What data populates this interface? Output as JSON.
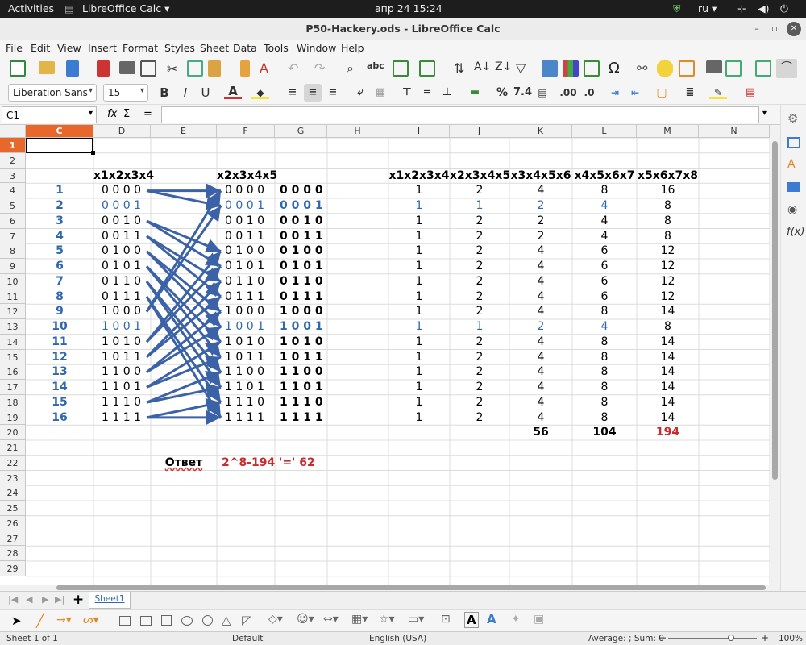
{
  "topbar": {
    "activities": "Activities",
    "app": "LibreOffice Calc",
    "datetime": "апр 24  15:24",
    "lang": "ru"
  },
  "window": {
    "title": "P50-Hackery.ods - LibreOffice Calc"
  },
  "menu": [
    "File",
    "Edit",
    "View",
    "Insert",
    "Format",
    "Styles",
    "Sheet",
    "Data",
    "Tools",
    "Window",
    "Help"
  ],
  "format": {
    "font": "Liberation Sans",
    "size": "15",
    "bold": "B",
    "italic": "I",
    "underline": "U"
  },
  "formula": {
    "cell_ref": "C1",
    "fx": "fx",
    "sigma": "Σ",
    "eq": "="
  },
  "columns": [
    "C",
    "D",
    "E",
    "F",
    "G",
    "H",
    "I",
    "J",
    "K",
    "L",
    "M",
    "N"
  ],
  "rows": [
    "1",
    "2",
    "3",
    "4",
    "5",
    "6",
    "7",
    "8",
    "9",
    "10",
    "11",
    "12",
    "13",
    "14",
    "15",
    "16",
    "17",
    "18",
    "19",
    "20",
    "21",
    "22",
    "23",
    "24",
    "25",
    "26",
    "27",
    "28",
    "29"
  ],
  "headers": {
    "d": "x1x2x3x4",
    "f": "x2x3x4x5",
    "i": "x1x2x3x4",
    "j": "x2x3x4x5",
    "k": "x3x4x5x6",
    "l": "x4x5x6x7",
    "m": "x5x6x7x8"
  },
  "table": [
    {
      "n": "1",
      "d": "0 0 0 0",
      "f": "0 0 0 0",
      "g": "0 0 0 0",
      "i": "1",
      "j": "2",
      "k": "4",
      "l": "8",
      "m": "16"
    },
    {
      "n": "2",
      "d": "0 0 0 1",
      "f": "0 0 0 1",
      "g": "0 0 0 1",
      "i": "1",
      "j": "1",
      "k": "2",
      "l": "4",
      "m": "8"
    },
    {
      "n": "3",
      "d": "0 0 1 0",
      "f": "0 0 1 0",
      "g": "0 0 1 0",
      "i": "1",
      "j": "2",
      "k": "2",
      "l": "4",
      "m": "8"
    },
    {
      "n": "4",
      "d": "0 0 1 1",
      "f": "0 0 1 1",
      "g": "0 0 1 1",
      "i": "1",
      "j": "2",
      "k": "2",
      "l": "4",
      "m": "8"
    },
    {
      "n": "5",
      "d": "0 1 0 0",
      "f": "0 1 0 0",
      "g": "0 1 0 0",
      "i": "1",
      "j": "2",
      "k": "4",
      "l": "6",
      "m": "12"
    },
    {
      "n": "6",
      "d": "0 1 0 1",
      "f": "0 1 0 1",
      "g": "0 1 0 1",
      "i": "1",
      "j": "2",
      "k": "4",
      "l": "6",
      "m": "12"
    },
    {
      "n": "7",
      "d": "0 1 1 0",
      "f": "0 1 1 0",
      "g": "0 1 1 0",
      "i": "1",
      "j": "2",
      "k": "4",
      "l": "6",
      "m": "12"
    },
    {
      "n": "8",
      "d": "0 1 1 1",
      "f": "0 1 1 1",
      "g": "0 1 1 1",
      "i": "1",
      "j": "2",
      "k": "4",
      "l": "6",
      "m": "12"
    },
    {
      "n": "9",
      "d": "1 0 0 0",
      "f": "1 0 0 0",
      "g": "1 0 0 0",
      "i": "1",
      "j": "2",
      "k": "4",
      "l": "8",
      "m": "14"
    },
    {
      "n": "10",
      "d": "1 0 0 1",
      "f": "1 0 0 1",
      "g": "1 0 0 1",
      "i": "1",
      "j": "1",
      "k": "2",
      "l": "4",
      "m": "8"
    },
    {
      "n": "11",
      "d": "1 0 1 0",
      "f": "1 0 1 0",
      "g": "1 0 1 0",
      "i": "1",
      "j": "2",
      "k": "4",
      "l": "8",
      "m": "14"
    },
    {
      "n": "12",
      "d": "1 0 1 1",
      "f": "1 0 1 1",
      "g": "1 0 1 1",
      "i": "1",
      "j": "2",
      "k": "4",
      "l": "8",
      "m": "14"
    },
    {
      "n": "13",
      "d": "1 1 0 0",
      "f": "1 1 0 0",
      "g": "1 1 0 0",
      "i": "1",
      "j": "2",
      "k": "4",
      "l": "8",
      "m": "14"
    },
    {
      "n": "14",
      "d": "1 1 0 1",
      "f": "1 1 0 1",
      "g": "1 1 0 1",
      "i": "1",
      "j": "2",
      "k": "4",
      "l": "8",
      "m": "14"
    },
    {
      "n": "15",
      "d": "1 1 1 0",
      "f": "1 1 1 0",
      "g": "1 1 1 0",
      "i": "1",
      "j": "2",
      "k": "4",
      "l": "8",
      "m": "14"
    },
    {
      "n": "16",
      "d": "1 1 1 1",
      "f": "1 1 1 1",
      "g": "1 1 1 1",
      "i": "1",
      "j": "2",
      "k": "4",
      "l": "8",
      "m": "14"
    }
  ],
  "totals": {
    "k": "56",
    "l": "104",
    "m": "194"
  },
  "answer": {
    "label": "Ответ",
    "value": "2^8-194  '=' 62"
  },
  "sheet_tab": "Sheet1",
  "status": {
    "sheet": "Sheet 1 of 1",
    "style": "Default",
    "lang": "English (USA)",
    "summary": "Average: ; Sum: 0",
    "zoom": "100%"
  },
  "colors": {
    "accent": "#e8672a",
    "blue": "#2f67b0",
    "red": "#cc2b2b"
  }
}
